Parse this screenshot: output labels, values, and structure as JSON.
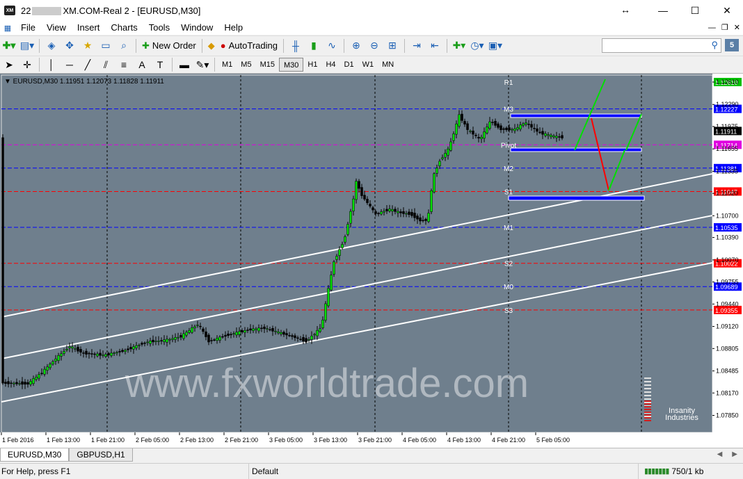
{
  "window": {
    "title_prefix": "22",
    "title_suffix": "XM.COM-Real 2 - [EURUSD,M30]",
    "logo": "XM"
  },
  "menu": [
    "File",
    "View",
    "Insert",
    "Charts",
    "Tools",
    "Window",
    "Help"
  ],
  "toolbar1": {
    "new_order": "New Order",
    "auto_trading": "AutoTrading",
    "notifications": "5"
  },
  "timeframes": [
    "M1",
    "M5",
    "M15",
    "M30",
    "H1",
    "H4",
    "D1",
    "W1",
    "MN"
  ],
  "active_timeframe": "M30",
  "chart": {
    "header": "EURUSD,M30  1.11951 1.12073 1.11828 1.11911",
    "watermark": "www.fxworldtrade.com",
    "logo_line1": "Insanity",
    "logo_line2": "Industries",
    "levels": [
      {
        "name": "R1",
        "price": 1.1261,
        "label": "1.12610",
        "color": "#00c000",
        "show_line": false,
        "tag": true
      },
      {
        "name": "M3",
        "price": 1.12227,
        "label": "1.12227",
        "color": "#0000ff",
        "show_line": true,
        "tag": true
      },
      {
        "name": "Pivot",
        "price": 1.11714,
        "label": "1.11714",
        "color": "#e000e0",
        "show_line": true,
        "tag": true
      },
      {
        "name": "M2",
        "price": 1.11381,
        "label": "1.11381",
        "color": "#0000ff",
        "show_line": true,
        "tag": true
      },
      {
        "name": "S1",
        "price": 1.11047,
        "label": "1.11047",
        "color": "#ff0000",
        "show_line": true,
        "tag": true
      },
      {
        "name": "M1",
        "price": 1.10535,
        "label": "1.10535",
        "color": "#0000ff",
        "show_line": true,
        "tag": true
      },
      {
        "name": "S2",
        "price": 1.10022,
        "label": "1.10022",
        "color": "#ff0000",
        "show_line": true,
        "tag": true
      },
      {
        "name": "M0",
        "price": 1.09689,
        "label": "1.09689",
        "color": "#0000ff",
        "show_line": true,
        "tag": true
      },
      {
        "name": "S3",
        "price": 1.09355,
        "label": "1.09355",
        "color": "#ff0000",
        "show_line": true,
        "tag": true
      }
    ],
    "current_price": "1.11911",
    "y_ticks": [
      "1.12610",
      "1.12290",
      "1.11975",
      "1.11655",
      "1.11335",
      "1.11020",
      "1.10700",
      "1.10390",
      "1.10070",
      "1.09755",
      "1.09440",
      "1.09120",
      "1.08805",
      "1.08485",
      "1.08170",
      "1.07850"
    ],
    "x_ticks": [
      "1 Feb 2016",
      "1 Feb 13:00",
      "1 Feb 21:00",
      "2 Feb 05:00",
      "2 Feb 13:00",
      "2 Feb 21:00",
      "3 Feb 05:00",
      "3 Feb 13:00",
      "3 Feb 21:00",
      "4 Feb 05:00",
      "4 Feb 13:00",
      "4 Feb 21:00",
      "5 Feb 05:00"
    ]
  },
  "chart_tabs": [
    "EURUSD,M30",
    "GBPUSD,H1"
  ],
  "status": {
    "help": "For Help, press F1",
    "profile": "Default",
    "traffic": "750/1 kb"
  },
  "colors": {
    "chart_bg": "#6f7f8d",
    "bull": "#00e000",
    "bear": "#000000",
    "channel": "#ffffff"
  }
}
